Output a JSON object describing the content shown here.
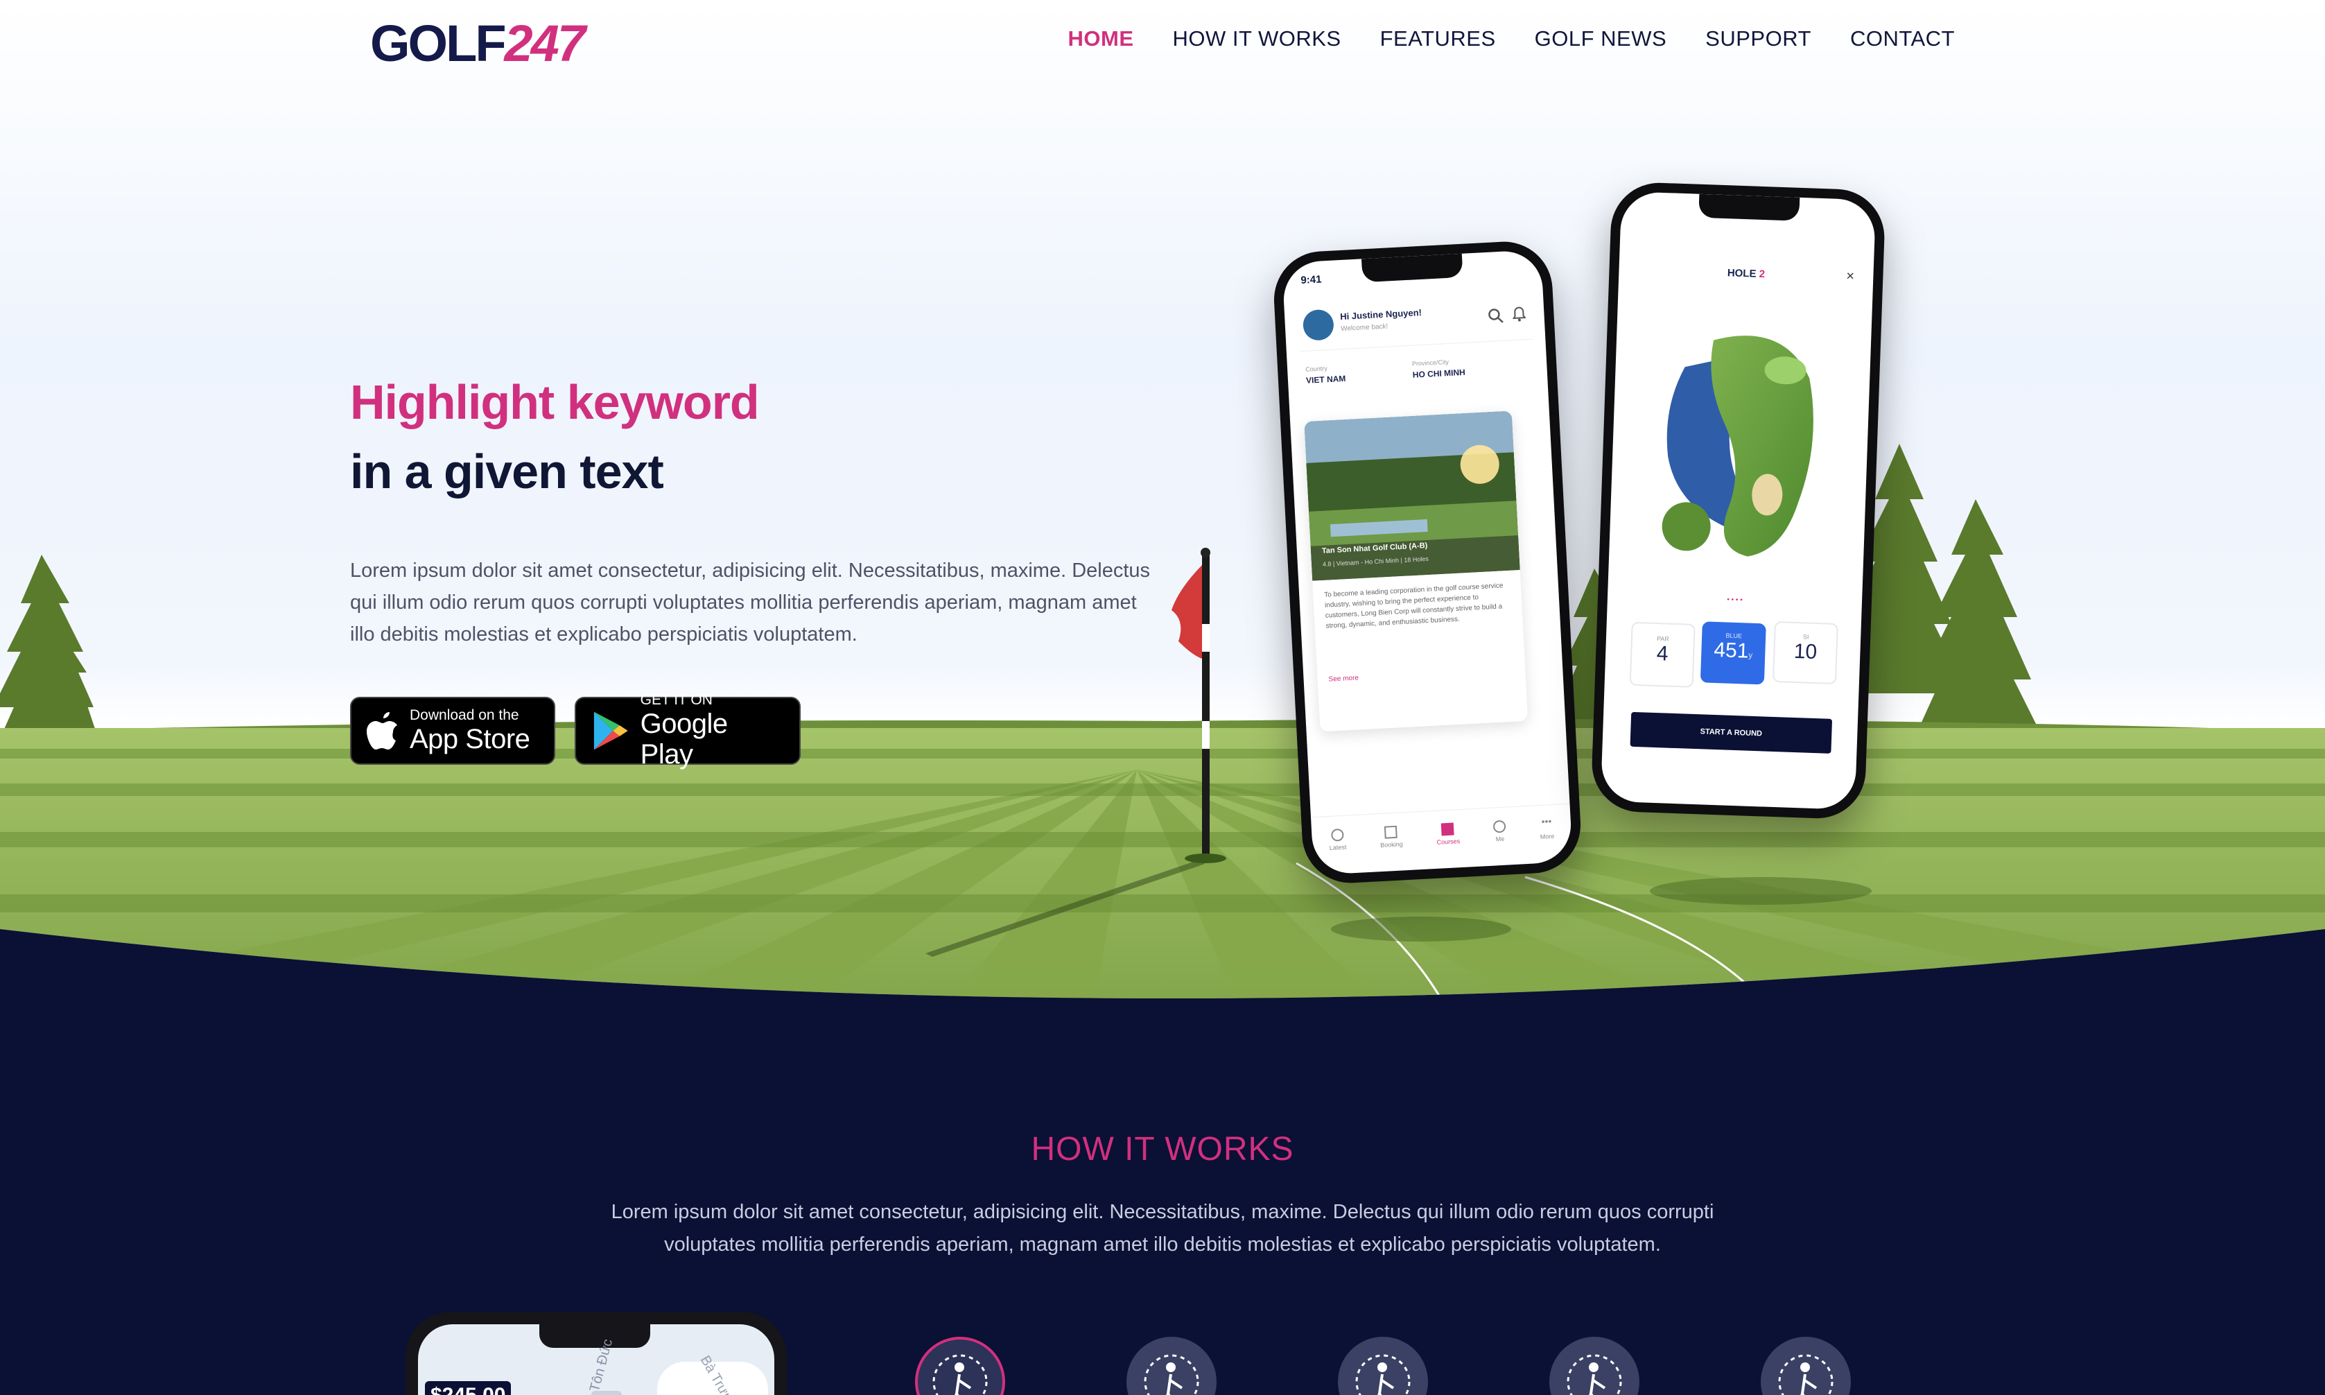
{
  "header": {
    "logo_part1": "GOLF",
    "logo_part2": "247",
    "nav": [
      "HOME",
      "HOW IT WORKS",
      "FEATURES",
      "GOLF NEWS",
      "SUPPORT",
      "CONTACT"
    ],
    "active_nav": "HOME"
  },
  "hero": {
    "title_highlight": "Highlight keyword",
    "title_rest": "in a given text",
    "description": "Lorem ipsum dolor sit amet consectetur, adipisicing elit. Necessitatibus, maxime. Delectus qui illum odio rerum quos corrupti voluptates mollitia perferendis aperiam, magnam amet illo debitis molestias et explicabo perspiciatis voluptatem.",
    "app_store": {
      "small": "Download on the",
      "big": "App Store"
    },
    "google_play": {
      "small": "GET IT ON",
      "big": "Google Play"
    }
  },
  "phone_left": {
    "time": "9:41",
    "greeting": "Hi Justine Nguyen!",
    "subgreeting": "Welcome back!",
    "country_label": "Country",
    "country": "VIET NAM",
    "province_label": "Province/City",
    "province": "HO CHI MINH",
    "course_name": "Tan Son Nhat Golf Club (A-B)",
    "course_meta": "4.8 | Vietnam - Ho Chi Minh | 18 Holes",
    "course_desc": "To become a leading corporation in the golf course service industry, wishing to bring the perfect experience to customers, Long Bien Corp will constantly strive to build a strong, dynamic, and enthusiastic business.",
    "see_more": "See more",
    "tabs": [
      "Latest",
      "Booking",
      "Courses",
      "Me",
      "More"
    ]
  },
  "phone_right": {
    "hole_label": "HOLE",
    "hole_number": "2",
    "par_label": "PAR",
    "par": "4",
    "blue_label": "BLUE",
    "distance": "451",
    "distance_unit": "y",
    "si_label": "SI",
    "si": "10",
    "start_button": "START A ROUND"
  },
  "how": {
    "title": "HOW IT WORKS",
    "description": "Lorem ipsum dolor sit amet consectetur, adipisicing elit. Necessitatibus, maxime. Delectus qui illum odio rerum quos corrupti voluptates mollitia perferendis aperiam, magnam amet illo debitis molestias et explicabo perspiciatis voluptatem.",
    "preview_price": "$245.00",
    "preview_map_label1": "Tôn Đức",
    "preview_map_label2": "Bà Trưng"
  },
  "colors": {
    "accent": "#d1307e",
    "navy": "#0b1035",
    "grass_light": "#8cad4f",
    "grass_dark": "#6f913a"
  }
}
